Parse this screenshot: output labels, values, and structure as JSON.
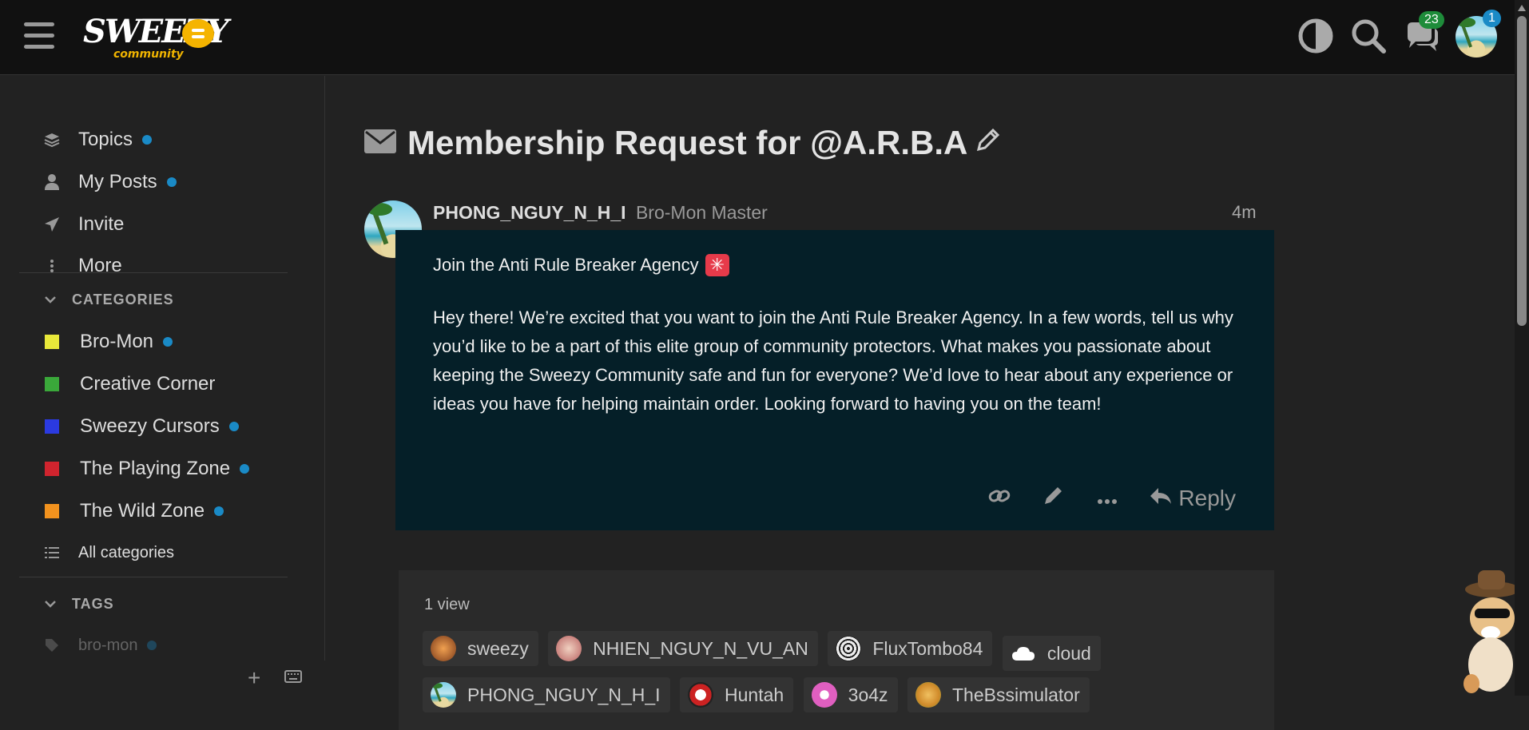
{
  "brand": {
    "logo_text": "SWEEZY",
    "logo_sub": "community"
  },
  "header": {
    "chat_badge": "23",
    "avatar_badge": "1"
  },
  "sidebar": {
    "nav": [
      {
        "label": "Topics",
        "icon": "layers-icon",
        "dot": true
      },
      {
        "label": "My Posts",
        "icon": "user-icon",
        "dot": true
      },
      {
        "label": "Invite",
        "icon": "paper-plane-icon",
        "dot": false
      },
      {
        "label": "More",
        "icon": "vertical-ellipsis-icon",
        "dot": false
      }
    ],
    "categories_heading": "CATEGORIES",
    "categories": [
      {
        "label": "Bro-Mon",
        "color": "#e8e83a",
        "dot": true
      },
      {
        "label": "Creative Corner",
        "color": "#3aa83a",
        "dot": false
      },
      {
        "label": "Sweezy Cursors",
        "color": "#2b3ae0",
        "dot": true
      },
      {
        "label": "The Playing Zone",
        "color": "#d0242e",
        "dot": true
      },
      {
        "label": "The Wild Zone",
        "color": "#f2921e",
        "dot": true
      }
    ],
    "all_categories": "All categories",
    "tags_heading": "TAGS",
    "tags": [
      {
        "label": "bro-mon",
        "dot": true
      }
    ]
  },
  "topic": {
    "title": "Membership Request for @A.R.B.A",
    "post": {
      "username": "PHONG_NGUY_N_H_I",
      "user_title": "Bro-Mon Master",
      "time": "4m",
      "line1": "Join the Anti Rule Breaker Agency",
      "paragraph": "Hey there! We’re excited that you want to join the Anti Rule Breaker Agency. In a few words, tell us why you’d like to be a part of this elite group of community protectors. What makes you passionate about keeping the Sweezy Community safe and fun for everyone? We’d love to hear about any experience or ideas you have for helping maintain order. Looking forward to having you on the team!",
      "reply_label": "Reply"
    },
    "views": "1 view",
    "participants": [
      {
        "name": "sweezy",
        "avatar_color": "#c86a2a"
      },
      {
        "name": "NHIEN_NGUY_N_VU_AN",
        "avatar_color": "#b86060"
      },
      {
        "name": "FluxTombo84",
        "avatar_color": "#eeeeee"
      },
      {
        "name": "cloud",
        "avatar_color": "#ffffff"
      },
      {
        "name": "PHONG_NGUY_N_H_I",
        "avatar_color": "#7ecfe9"
      },
      {
        "name": "Huntah",
        "avatar_color": "#cc2222"
      },
      {
        "name": "3o4z",
        "avatar_color": "#e05fc0"
      },
      {
        "name": "TheBssimulator",
        "avatar_color": "#d08a2a"
      }
    ]
  }
}
